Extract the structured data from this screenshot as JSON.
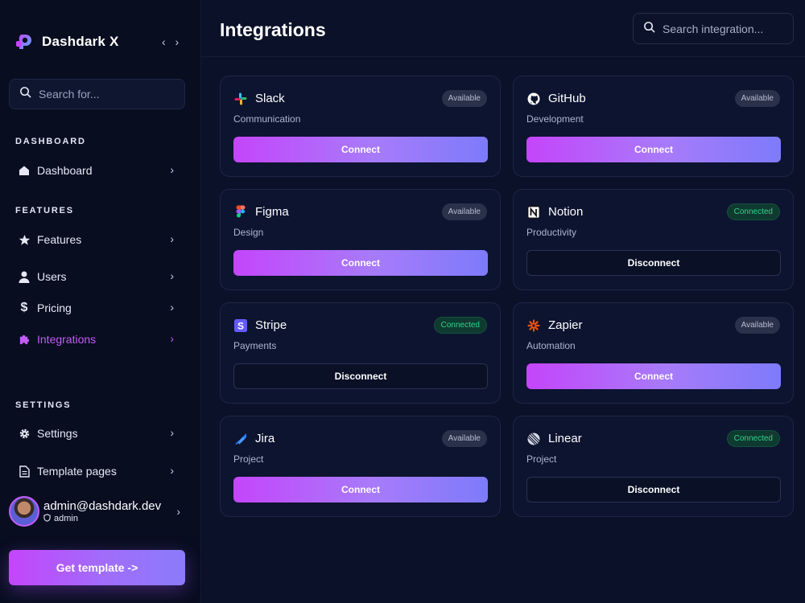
{
  "brand": {
    "name": "Dashdark X",
    "collapse": "‹ ›"
  },
  "sidebar_search": {
    "placeholder": "Search for..."
  },
  "sections": {
    "dashboard": "DASHBOARD",
    "features": "FEATURES",
    "settings": "SETTINGS"
  },
  "nav": {
    "dashboard": "Dashboard",
    "features": "Features",
    "users": "Users",
    "pricing": "Pricing",
    "integrations": "Integrations",
    "settings": "Settings",
    "template_pages": "Template pages",
    "chevron": "›"
  },
  "user": {
    "email": "admin@dashdark.dev",
    "role": "admin"
  },
  "get_template": "Get template ->",
  "header": {
    "title": "Integrations",
    "search_placeholder": "Search integration..."
  },
  "colors": {
    "accent": "#c35cf7",
    "connected": "#2fd48a",
    "background": "#0b1128"
  },
  "integrations": [
    {
      "name": "Slack",
      "category": "Communication",
      "status": "Available",
      "action": "Connect",
      "icon": "slack-icon"
    },
    {
      "name": "GitHub",
      "category": "Development",
      "status": "Available",
      "action": "Connect",
      "icon": "github-icon"
    },
    {
      "name": "Figma",
      "category": "Design",
      "status": "Available",
      "action": "Connect",
      "icon": "figma-icon"
    },
    {
      "name": "Notion",
      "category": "Productivity",
      "status": "Connected",
      "action": "Disconnect",
      "icon": "notion-icon"
    },
    {
      "name": "Stripe",
      "category": "Payments",
      "status": "Connected",
      "action": "Disconnect",
      "icon": "stripe-icon"
    },
    {
      "name": "Zapier",
      "category": "Automation",
      "status": "Available",
      "action": "Connect",
      "icon": "zapier-icon"
    },
    {
      "name": "Jira",
      "category": "Project",
      "status": "Available",
      "action": "Connect",
      "icon": "jira-icon"
    },
    {
      "name": "Linear",
      "category": "Project",
      "status": "Connected",
      "action": "Disconnect",
      "icon": "linear-icon"
    }
  ]
}
